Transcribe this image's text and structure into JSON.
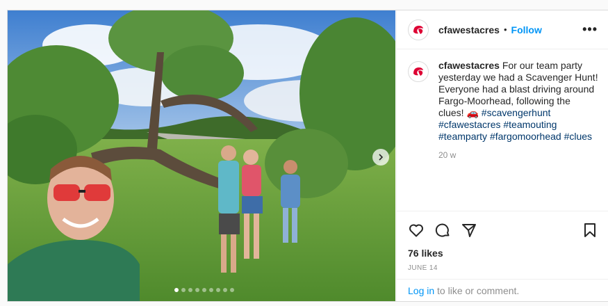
{
  "post": {
    "username": "cfawestacres",
    "separator": "•",
    "follow_label": "Follow",
    "more_label": "•••",
    "caption": {
      "username": "cfawestacres",
      "text": " For our team party yesterday we had a Scavenger Hunt! Everyone had a blast driving around Fargo-Moorhead, following the clues! ",
      "emoji": "🚗",
      "hashtags": [
        "#scavengerhunt",
        "#cfawestacres",
        "#teamouting",
        "#teamparty",
        "#fargomoorhead",
        "#clues"
      ]
    },
    "age": "20 w",
    "likes": "76 likes",
    "date": "JUNE 14",
    "login_link": "Log in",
    "login_rest": " to like or comment.",
    "carousel": {
      "count": 9,
      "active": 0
    }
  },
  "icons": {
    "like": "heart-icon",
    "comment": "comment-icon",
    "share": "share-icon",
    "save": "bookmark-icon",
    "next": "chevron-right-icon",
    "logo": "chick-fil-a-logo"
  },
  "colors": {
    "brand_red": "#dd0033",
    "link_blue": "#0095f6",
    "hashtag": "#00376b",
    "muted": "#8e8e8e"
  }
}
